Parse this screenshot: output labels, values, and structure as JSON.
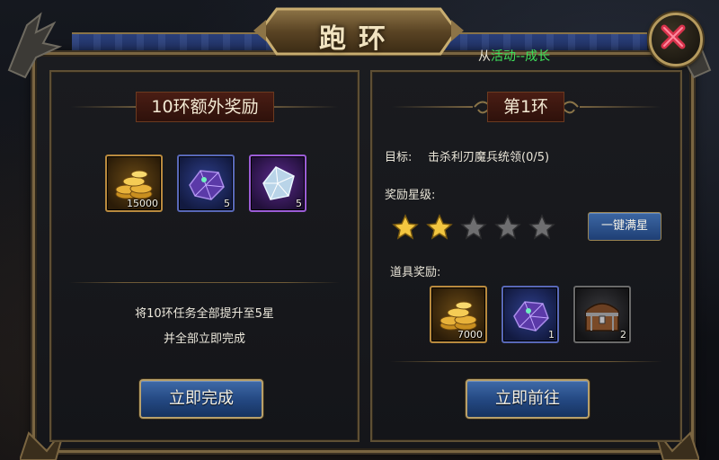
{
  "title": "跑环",
  "source": {
    "prefix": "从",
    "link": "活动--成长"
  },
  "close_label": "×",
  "left_panel": {
    "heading": "10环额外奖励",
    "rewards": [
      {
        "kind": "gold-coins",
        "count": "15000",
        "color": "#b98a3e"
      },
      {
        "kind": "purple-crystal",
        "count": "5",
        "color": "#5868b8"
      },
      {
        "kind": "white-gem",
        "count": "5",
        "color": "#9b5cd6"
      }
    ],
    "desc_line1": "将10环任务全部提升至5星",
    "desc_line2": "并全部立即完成",
    "button": "立即完成"
  },
  "right_panel": {
    "heading": "第1环",
    "goal_label": "目标:",
    "goal_value": "击杀利刃魔兵统领(0/5)",
    "star_label": "奖励星级:",
    "stars": {
      "filled": 2,
      "total": 5
    },
    "max_star_button": "一键满星",
    "item_label": "道具奖励:",
    "rewards": [
      {
        "kind": "gold-coins",
        "count": "7000"
      },
      {
        "kind": "purple-crystal",
        "count": "1"
      },
      {
        "kind": "treasure-chest",
        "count": "2"
      }
    ],
    "button": "立即前往"
  },
  "colors": {
    "accent_gold": "#b8a06a",
    "link_green": "#3fe05b",
    "button_blue": "#234780"
  }
}
